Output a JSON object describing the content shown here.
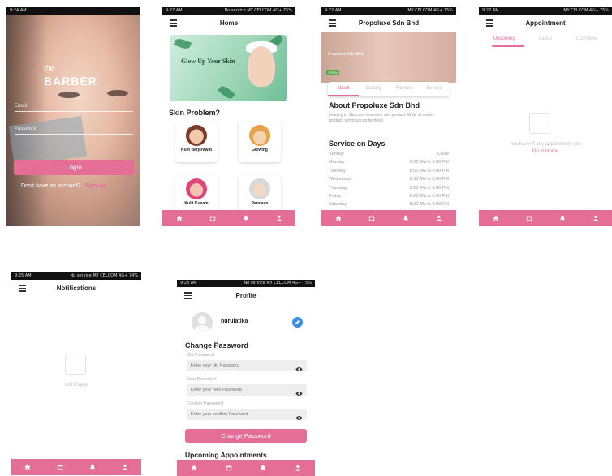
{
  "statusbar": {
    "s1": {
      "left": "9:24 AM",
      "right": ""
    },
    "s2": {
      "left": "9:27 AM",
      "right": "No service  MY CELCOM 4G+ 75%"
    },
    "s3": {
      "left": "9:22 AM",
      "right": "MY CELCOM 4G+ 75%"
    },
    "s4": {
      "left": "9:22 AM",
      "right": "MY CELCOM 4G+ 75%"
    },
    "s5": {
      "left": "9:25 AM",
      "right": "No service  MY CELCOM 4G+ 74%"
    },
    "s6": {
      "left": "9:23 AM",
      "right": "No service  MY CELCOM 4G+ 75%"
    }
  },
  "login": {
    "brand_small": "the",
    "brand_big": "BARBER",
    "email_placeholder": "Email",
    "password_placeholder": "Password",
    "login_button": "Login",
    "no_account_text": "Don't have an account?",
    "signup_link": "Sign up"
  },
  "home": {
    "title": "Home",
    "banner_title": "Glow Up Your Skin",
    "banner_sub": "",
    "section_title": "Skin Problem?",
    "cards": [
      {
        "label": "Kulit Berjerawat"
      },
      {
        "label": "Glowing"
      },
      {
        "label": "Kulit Kusam"
      },
      {
        "label": "Penuaan"
      }
    ]
  },
  "company": {
    "title": "Propoluxe Sdn Bhd",
    "hero_text": "Propoluxe Sdn Bhd",
    "hero_badge": "OPEN",
    "tabs": [
      "About",
      "Gallery",
      "Review",
      "Service"
    ],
    "about_heading": "About  Propoluxe Sdn Bhd",
    "about_text": "Leading in Skincare treatment and product. Wide of variety product, services can be hired.",
    "service_heading": "Service on Days",
    "hours": [
      {
        "day": "Sunday",
        "time": "Close"
      },
      {
        "day": "Monday",
        "time": "8:00 AM to 8:00 PM"
      },
      {
        "day": "Tuesday",
        "time": "8:00 AM to 8:00 PM"
      },
      {
        "day": "Wednesday",
        "time": "8:00 AM to 8:00 PM"
      },
      {
        "day": "Thursday",
        "time": "8:00 AM to 8:00 PM"
      },
      {
        "day": "Friday",
        "time": "8:00 AM to 8:00 PM"
      },
      {
        "day": "Saturday",
        "time": "8:00 AM to 8:00 PM"
      }
    ]
  },
  "appointment": {
    "title": "Appointment",
    "tabs": [
      "Upcoming",
      "Latest",
      "Complete"
    ],
    "empty_text": "You haven't any appointment yet.",
    "go_home": "Go to Home"
  },
  "notifications": {
    "title": "Notifications",
    "empty_text": "List Empty"
  },
  "profile": {
    "title": "Profile",
    "username": "nurulatika",
    "change_password_heading": "Change Password",
    "old_label": "Old Password",
    "old_placeholder": "Enter your old Password",
    "new_label": "New Password",
    "new_placeholder": "Enter your new Password",
    "confirm_label": "Confirm Password",
    "confirm_placeholder": "Enter your confirm Password",
    "change_button": "Change Password",
    "upcoming_heading": "Upcoming Appointments"
  },
  "icons": {
    "nav": [
      "home-icon",
      "calendar-icon",
      "bell-icon",
      "person-icon"
    ],
    "menu": "menu-icon",
    "eye": "eye-icon",
    "edit": "pencil-icon"
  },
  "colors": {
    "accent": "#e56e97",
    "edit_blue": "#3a8ee8"
  }
}
